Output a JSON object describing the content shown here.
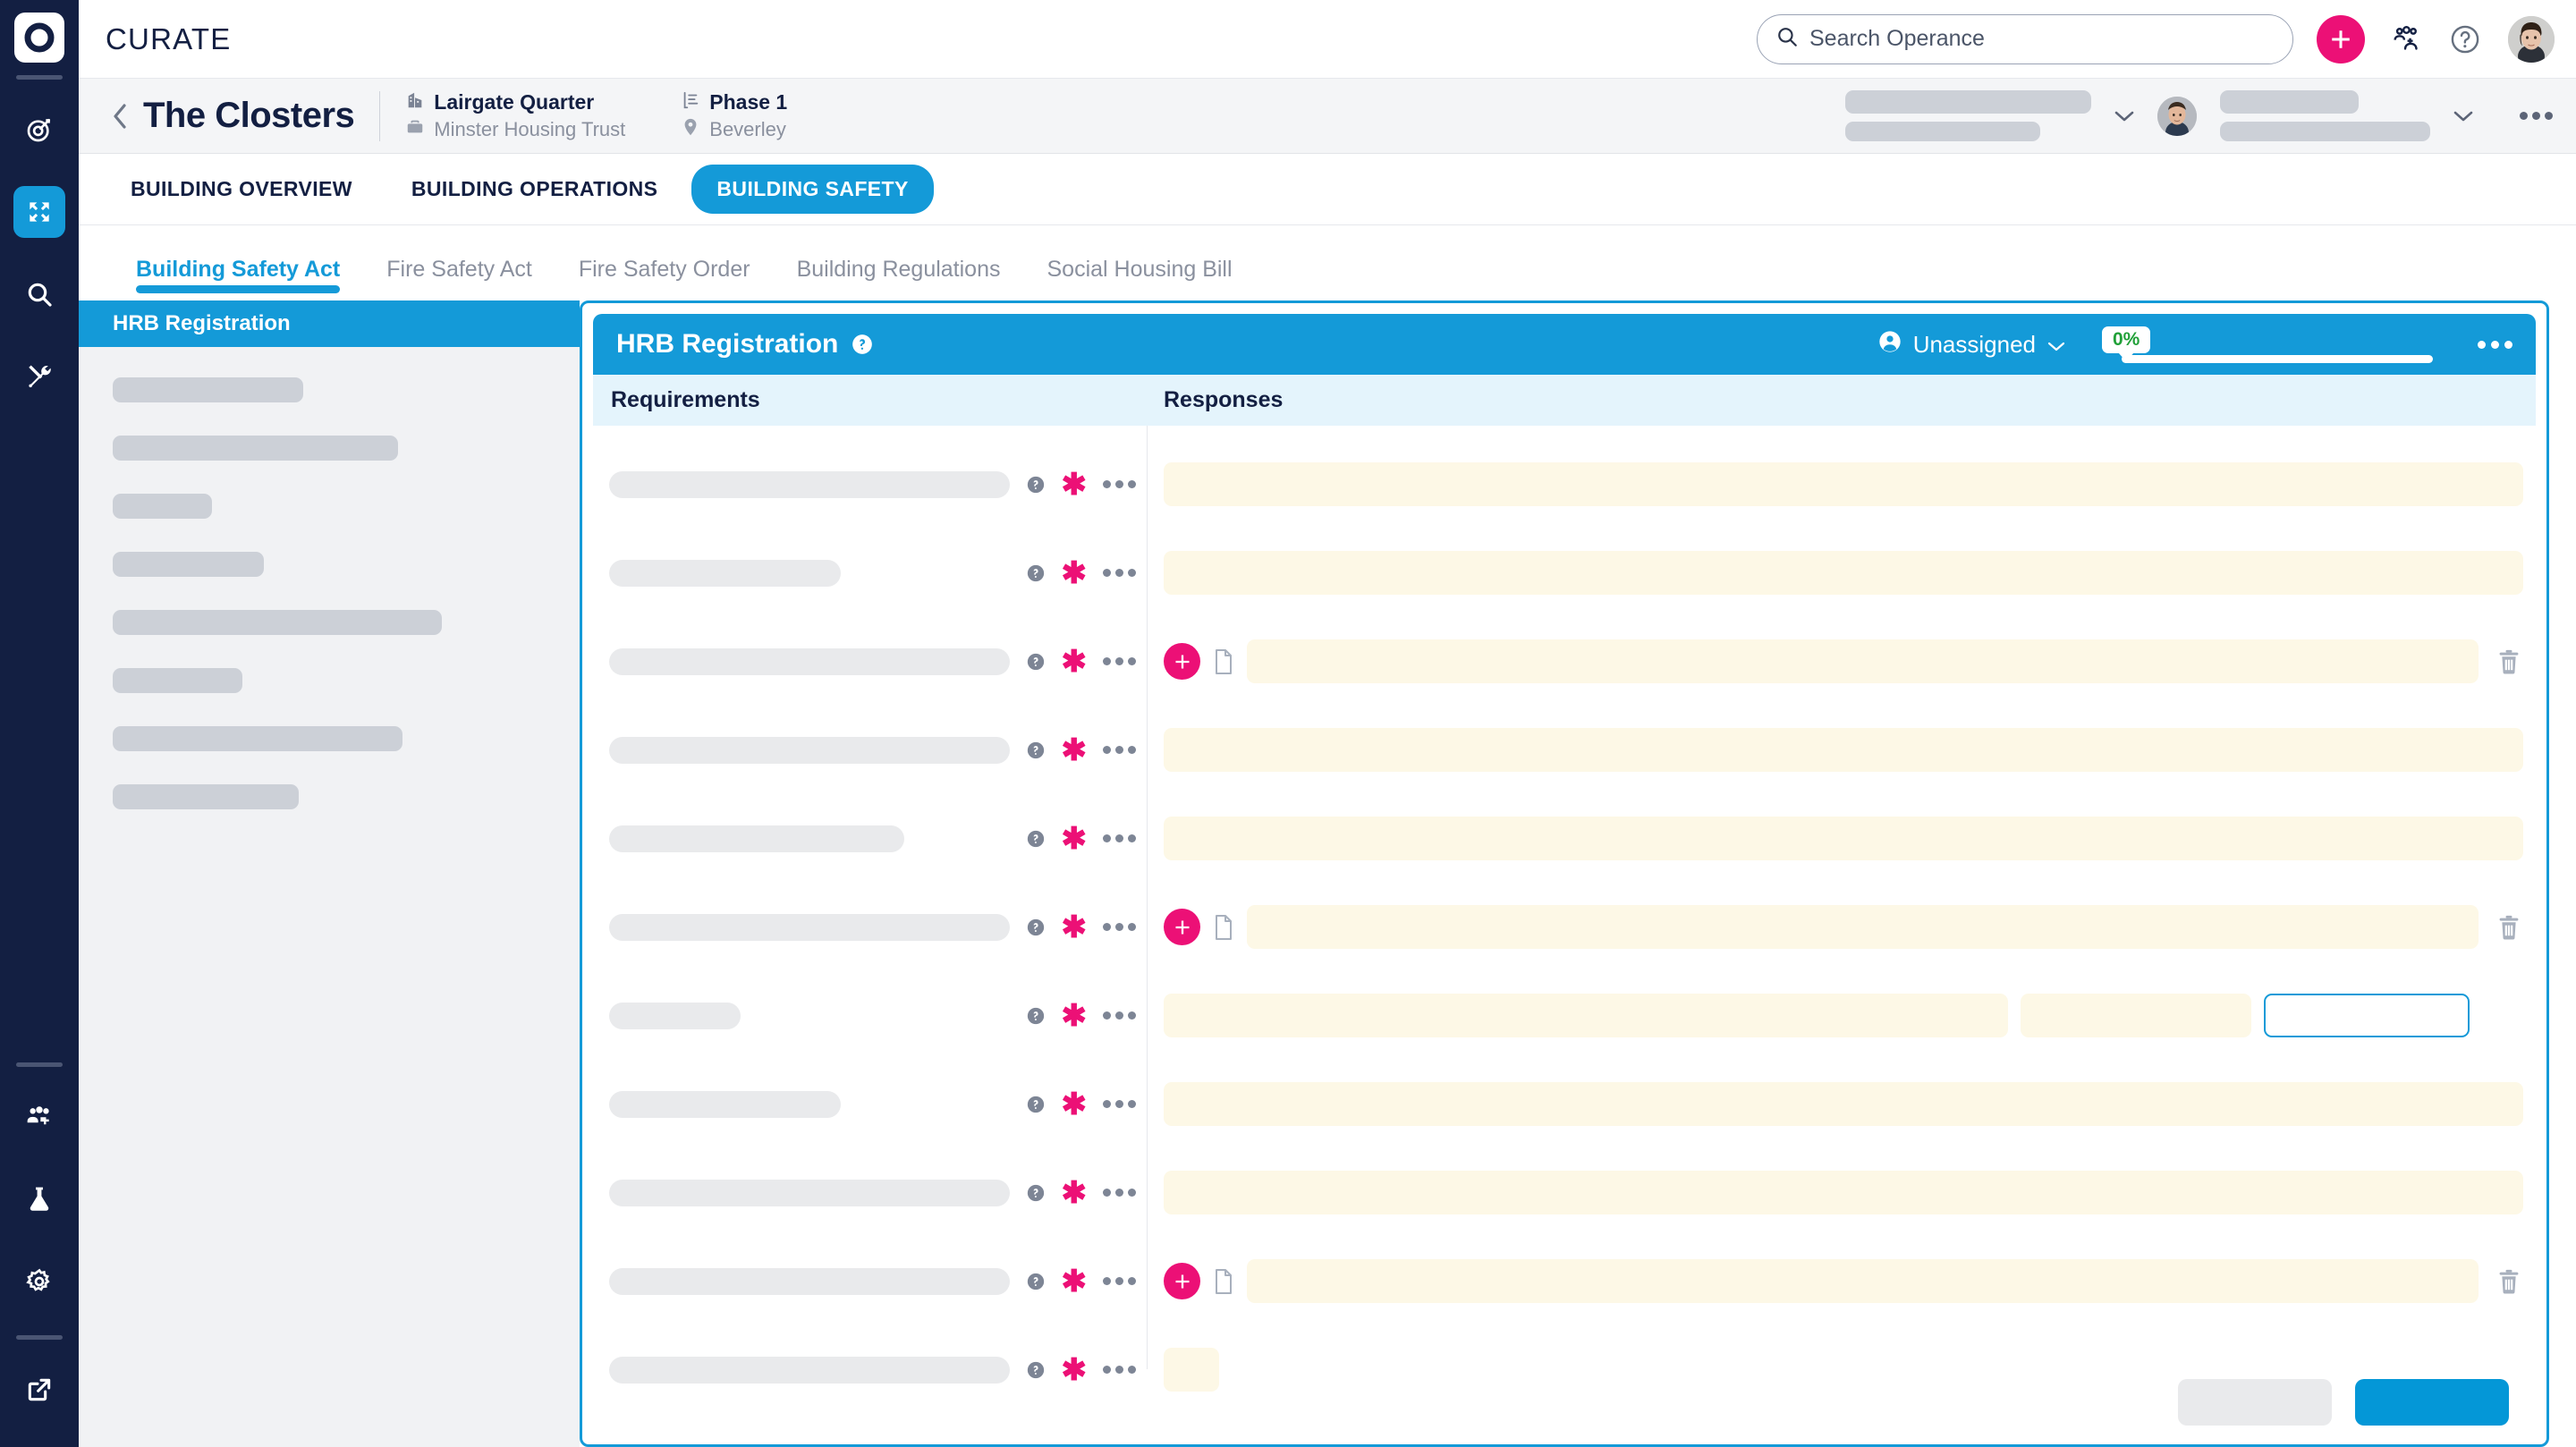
{
  "rail": {
    "logo": "operance-logo-icon",
    "items": [
      {
        "name": "target-icon",
        "active": false
      },
      {
        "name": "collapse-arrows-icon",
        "active": true
      },
      {
        "name": "search-icon",
        "active": false
      },
      {
        "name": "tools-icon",
        "active": false
      }
    ],
    "bottom": [
      {
        "name": "add-people-icon"
      },
      {
        "name": "flask-icon"
      },
      {
        "name": "gear-icon"
      },
      {
        "name": "external-link-icon"
      }
    ]
  },
  "topbar": {
    "brand": "CURATE",
    "search": {
      "placeholder": "Search Operance",
      "value": ""
    },
    "add_label": "+",
    "icons": [
      "add-user-icon",
      "help-circle-icon",
      "user-avatar"
    ]
  },
  "context": {
    "back_label": "‹",
    "title": "The Closters",
    "building": {
      "name": "Lairgate Quarter",
      "owner": "Minster Housing Trust"
    },
    "phase": {
      "name": "Phase 1",
      "location": "Beverley"
    }
  },
  "primary_tabs": [
    {
      "label": "BUILDING OVERVIEW",
      "active": false
    },
    {
      "label": "BUILDING OPERATIONS",
      "active": false
    },
    {
      "label": "BUILDING SAFETY",
      "active": true
    }
  ],
  "secondary_tabs": [
    {
      "label": "Building Safety Act",
      "active": true
    },
    {
      "label": "Fire Safety Act",
      "active": false
    },
    {
      "label": "Fire Safety Order",
      "active": false
    },
    {
      "label": "Building Regulations",
      "active": false
    },
    {
      "label": "Social Housing Bill",
      "active": false
    }
  ],
  "sidebar": {
    "active_item": "HRB Registration",
    "skeleton_widths": [
      "44%",
      "66%",
      "23%",
      "35%",
      "76%",
      "30%",
      "67%",
      "43%"
    ]
  },
  "card": {
    "title": "HRB Registration",
    "help_icon": "help-circle-icon",
    "assignee": {
      "label": "Unassigned",
      "icon": "user-circle-icon",
      "chevron": "chevron-down-icon"
    },
    "progress": {
      "percent_label": "0%",
      "percent_value": 0,
      "color": "#21a038"
    },
    "menu_icon": "more-options-icon",
    "columns": {
      "requirements": "Requirements",
      "responses": "Responses"
    },
    "accent_color": "#149ad8",
    "pink_color": "#ec1076",
    "rows": [
      {
        "req_width": "96%",
        "help": true,
        "required": true,
        "menu": true,
        "response": {
          "type": "single",
          "fields": [
            {
              "w": "full"
            }
          ]
        }
      },
      {
        "req_width": "44%",
        "help": true,
        "required": true,
        "menu": true,
        "response": {
          "type": "single",
          "fields": [
            {
              "w": "full"
            }
          ]
        }
      },
      {
        "req_width": "84%",
        "help": true,
        "required": true,
        "menu": true,
        "response": {
          "type": "upload",
          "add": true,
          "doc": true,
          "delete": true,
          "fields": [
            {
              "w": "full"
            }
          ]
        }
      },
      {
        "req_width": "80%",
        "help": true,
        "required": true,
        "menu": true,
        "response": {
          "type": "single",
          "fields": [
            {
              "w": "full"
            }
          ]
        }
      },
      {
        "req_width": "56%",
        "help": true,
        "required": true,
        "menu": true,
        "response": {
          "type": "single",
          "fields": [
            {
              "w": "full"
            }
          ]
        }
      },
      {
        "req_width": "84%",
        "help": true,
        "required": true,
        "menu": true,
        "response": {
          "type": "upload",
          "add": true,
          "doc": true,
          "delete": true,
          "fields": [
            {
              "w": "full"
            }
          ]
        }
      },
      {
        "req_width": "25%",
        "help": true,
        "required": true,
        "menu": true,
        "response": {
          "type": "multi",
          "fields": [
            {
              "w": "full"
            },
            {
              "w": "med"
            },
            {
              "w": "focused"
            }
          ]
        }
      },
      {
        "req_width": "44%",
        "help": true,
        "required": true,
        "menu": true,
        "response": {
          "type": "single",
          "fields": [
            {
              "w": "full"
            }
          ]
        }
      },
      {
        "req_width": "80%",
        "help": true,
        "required": true,
        "menu": true,
        "response": {
          "type": "single",
          "fields": [
            {
              "w": "full"
            }
          ]
        }
      },
      {
        "req_width": "84%",
        "help": true,
        "required": true,
        "menu": true,
        "response": {
          "type": "upload",
          "add": true,
          "doc": true,
          "delete": true,
          "fields": [
            {
              "w": "full"
            }
          ]
        }
      },
      {
        "req_width": "80%",
        "help": true,
        "required": true,
        "menu": true,
        "response": {
          "type": "small",
          "fields": [
            {
              "w": "sm"
            }
          ]
        }
      }
    ],
    "footer": {
      "secondary_button": "",
      "primary_button": ""
    }
  }
}
